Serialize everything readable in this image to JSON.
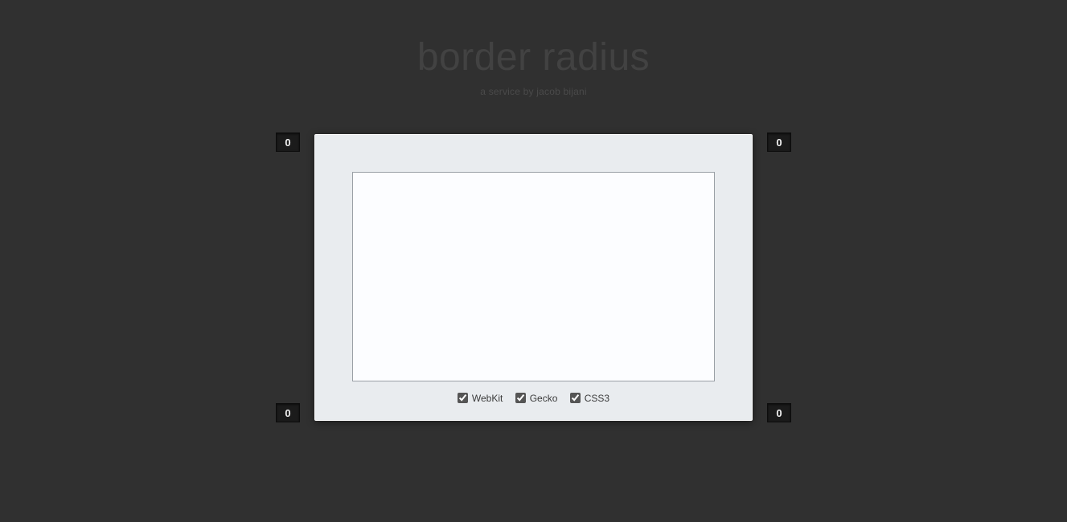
{
  "header": {
    "title": "border radius",
    "subtitle": "a service by jacob bijani"
  },
  "corners": {
    "top_left": "0",
    "top_right": "0",
    "bottom_left": "0",
    "bottom_right": "0"
  },
  "options": {
    "webkit": {
      "label": "WebKit",
      "checked": true
    },
    "gecko": {
      "label": "Gecko",
      "checked": true
    },
    "css3": {
      "label": "CSS3",
      "checked": true
    }
  }
}
